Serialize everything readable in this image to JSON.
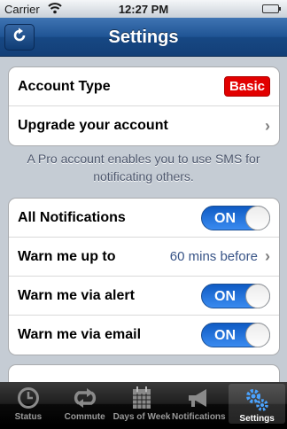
{
  "status_bar": {
    "carrier": "Carrier",
    "time": "12:27 PM"
  },
  "nav": {
    "title": "Settings",
    "left_icon": "refresh-icon"
  },
  "account": {
    "type_label": "Account Type",
    "type_badge": "Basic",
    "upgrade_label": "Upgrade your account",
    "note": "A Pro account enables you to use SMS for notificating others."
  },
  "notifications": {
    "all_label": "All Notifications",
    "all_state": "ON",
    "warn_up_to_label": "Warn me up to",
    "warn_up_to_value": "60 mins before",
    "alert_label": "Warn me via alert",
    "alert_state": "ON",
    "email_label": "Warn me via email",
    "email_state": "ON"
  },
  "tabs": [
    {
      "label": "Status",
      "icon": "clock-icon",
      "active": false
    },
    {
      "label": "Commute",
      "icon": "repeat-arrows-icon",
      "active": false
    },
    {
      "label": "Days of Week",
      "icon": "calendar-icon",
      "active": false
    },
    {
      "label": "Notifications",
      "icon": "megaphone-icon",
      "active": false
    },
    {
      "label": "Settings",
      "icon": "gears-icon",
      "active": true
    }
  ],
  "colors": {
    "nav": "#1f5494",
    "toggle_on": "#1a6fd8",
    "badge": "#e20000",
    "value_text": "#385487"
  }
}
